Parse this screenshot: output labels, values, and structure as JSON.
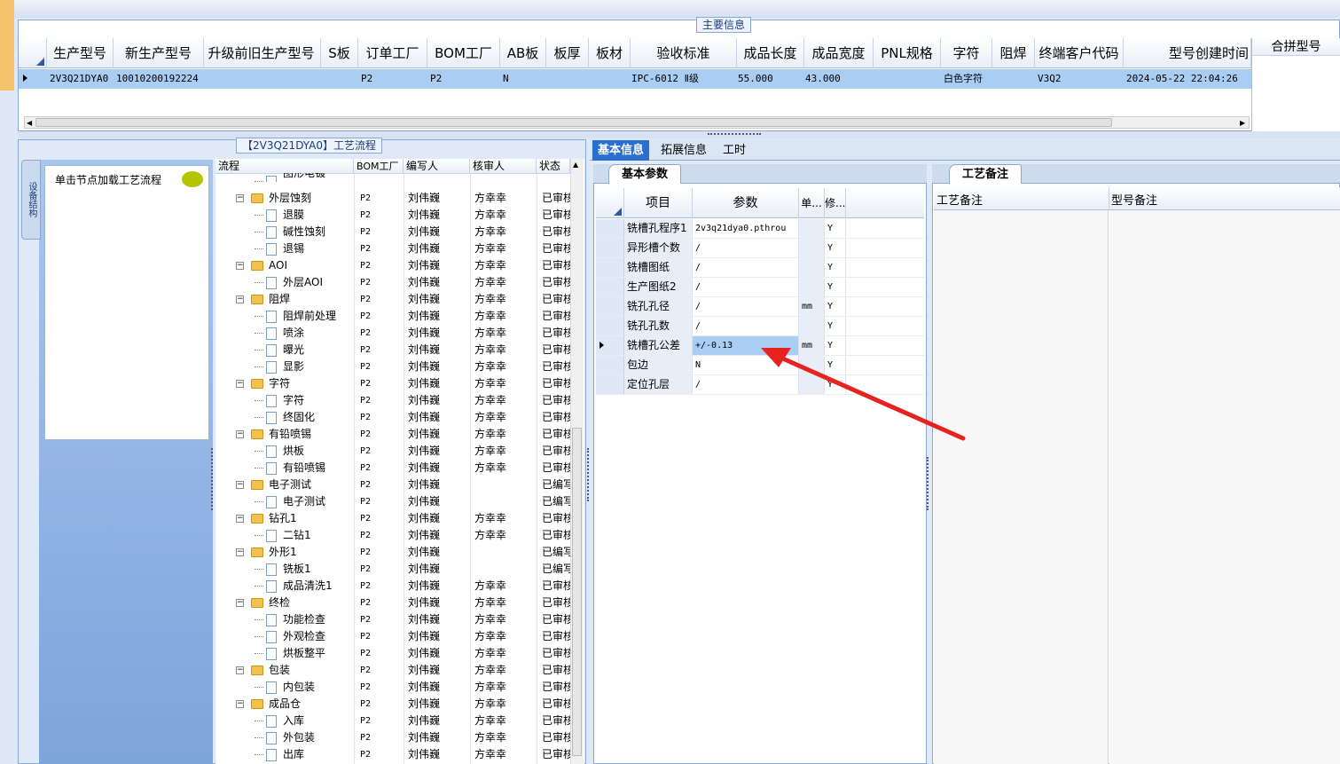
{
  "main_info": {
    "title": "主要信息",
    "columns": [
      "生产型号",
      "新生产型号",
      "升级前旧生产型号",
      "S板",
      "订单工厂",
      "BOM工厂",
      "AB板",
      "板厚",
      "板材",
      "验收标准",
      "成品长度",
      "成品宽度",
      "PNL规格",
      "字符",
      "阻焊",
      "终端客户代码",
      "型号创建时间"
    ],
    "row": [
      "2V3Q21DYA0",
      "10010200192224",
      "",
      "",
      "P2",
      "P2",
      "N",
      "",
      "",
      "IPC-6012 Ⅱ级",
      "55.000",
      "43.000",
      "",
      "白色字符",
      "",
      "V3Q2",
      "2024-05-22 22:04:26"
    ],
    "combo_header": "合拼型号"
  },
  "flow": {
    "title": "【2V3Q21DYA0】工艺流程",
    "side_tab": "设备结构",
    "node_hint": "单击节点加载工艺流程",
    "columns": [
      "流程",
      "BOM工厂",
      "编写人",
      "核审人",
      "状态"
    ],
    "rows": [
      {
        "level": 1,
        "name": "图形电镀",
        "bom": "",
        "writer": "",
        "reviewer": "",
        "status": ""
      },
      {
        "level": 0,
        "name": "外层蚀刻",
        "bom": "P2",
        "writer": "刘伟巍",
        "reviewer": "方幸幸",
        "status": "已审核"
      },
      {
        "level": 1,
        "name": "退膜",
        "bom": "P2",
        "writer": "刘伟巍",
        "reviewer": "方幸幸",
        "status": "已审核"
      },
      {
        "level": 1,
        "name": "碱性蚀刻",
        "bom": "P2",
        "writer": "刘伟巍",
        "reviewer": "方幸幸",
        "status": "已审核"
      },
      {
        "level": 1,
        "name": "退锡",
        "bom": "P2",
        "writer": "刘伟巍",
        "reviewer": "方幸幸",
        "status": "已审核"
      },
      {
        "level": 0,
        "name": "AOI",
        "bom": "P2",
        "writer": "刘伟巍",
        "reviewer": "方幸幸",
        "status": "已审核"
      },
      {
        "level": 1,
        "name": "外层AOI",
        "bom": "P2",
        "writer": "刘伟巍",
        "reviewer": "方幸幸",
        "status": "已审核"
      },
      {
        "level": 0,
        "name": "阻焊",
        "bom": "P2",
        "writer": "刘伟巍",
        "reviewer": "方幸幸",
        "status": "已审核"
      },
      {
        "level": 1,
        "name": "阻焊前处理",
        "bom": "P2",
        "writer": "刘伟巍",
        "reviewer": "方幸幸",
        "status": "已审核"
      },
      {
        "level": 1,
        "name": "喷涂",
        "bom": "P2",
        "writer": "刘伟巍",
        "reviewer": "方幸幸",
        "status": "已审核"
      },
      {
        "level": 1,
        "name": "曝光",
        "bom": "P2",
        "writer": "刘伟巍",
        "reviewer": "方幸幸",
        "status": "已审核"
      },
      {
        "level": 1,
        "name": "显影",
        "bom": "P2",
        "writer": "刘伟巍",
        "reviewer": "方幸幸",
        "status": "已审核"
      },
      {
        "level": 0,
        "name": "字符",
        "bom": "P2",
        "writer": "刘伟巍",
        "reviewer": "方幸幸",
        "status": "已审核"
      },
      {
        "level": 1,
        "name": "字符",
        "bom": "P2",
        "writer": "刘伟巍",
        "reviewer": "方幸幸",
        "status": "已审核"
      },
      {
        "level": 1,
        "name": "终固化",
        "bom": "P2",
        "writer": "刘伟巍",
        "reviewer": "方幸幸",
        "status": "已审核"
      },
      {
        "level": 0,
        "name": "有铅喷锡",
        "bom": "P2",
        "writer": "刘伟巍",
        "reviewer": "方幸幸",
        "status": "已审核"
      },
      {
        "level": 1,
        "name": "烘板",
        "bom": "P2",
        "writer": "刘伟巍",
        "reviewer": "方幸幸",
        "status": "已审核"
      },
      {
        "level": 1,
        "name": "有铅喷锡",
        "bom": "P2",
        "writer": "刘伟巍",
        "reviewer": "方幸幸",
        "status": "已审核"
      },
      {
        "level": 0,
        "name": "电子测试",
        "bom": "P2",
        "writer": "刘伟巍",
        "reviewer": "",
        "status": "已编写"
      },
      {
        "level": 1,
        "name": "电子测试",
        "bom": "P2",
        "writer": "刘伟巍",
        "reviewer": "",
        "status": "已编写"
      },
      {
        "level": 0,
        "name": "钻孔1",
        "bom": "P2",
        "writer": "刘伟巍",
        "reviewer": "方幸幸",
        "status": "已审核"
      },
      {
        "level": 1,
        "name": "二钻1",
        "bom": "P2",
        "writer": "刘伟巍",
        "reviewer": "方幸幸",
        "status": "已审核"
      },
      {
        "level": 0,
        "name": "外形1",
        "bom": "P2",
        "writer": "刘伟巍",
        "reviewer": "",
        "status": "已编写"
      },
      {
        "level": 1,
        "name": "铣板1",
        "bom": "P2",
        "writer": "刘伟巍",
        "reviewer": "",
        "status": "已编写"
      },
      {
        "level": 1,
        "name": "成品清洗1",
        "bom": "P2",
        "writer": "刘伟巍",
        "reviewer": "方幸幸",
        "status": "已审核"
      },
      {
        "level": 0,
        "name": "终检",
        "bom": "P2",
        "writer": "刘伟巍",
        "reviewer": "方幸幸",
        "status": "已审核"
      },
      {
        "level": 1,
        "name": "功能检查",
        "bom": "P2",
        "writer": "刘伟巍",
        "reviewer": "方幸幸",
        "status": "已审核"
      },
      {
        "level": 1,
        "name": "外观检查",
        "bom": "P2",
        "writer": "刘伟巍",
        "reviewer": "方幸幸",
        "status": "已审核"
      },
      {
        "level": 1,
        "name": "烘板整平",
        "bom": "P2",
        "writer": "刘伟巍",
        "reviewer": "方幸幸",
        "status": "已审核"
      },
      {
        "level": 0,
        "name": "包装",
        "bom": "P2",
        "writer": "刘伟巍",
        "reviewer": "方幸幸",
        "status": "已审核"
      },
      {
        "level": 1,
        "name": "内包装",
        "bom": "P2",
        "writer": "刘伟巍",
        "reviewer": "方幸幸",
        "status": "已审核"
      },
      {
        "level": 0,
        "name": "成品仓",
        "bom": "P2",
        "writer": "刘伟巍",
        "reviewer": "方幸幸",
        "status": "已审核"
      },
      {
        "level": 1,
        "name": "入库",
        "bom": "P2",
        "writer": "刘伟巍",
        "reviewer": "方幸幸",
        "status": "已审核"
      },
      {
        "level": 1,
        "name": "外包装",
        "bom": "P2",
        "writer": "刘伟巍",
        "reviewer": "方幸幸",
        "status": "已审核"
      },
      {
        "level": 1,
        "name": "出库",
        "bom": "P2",
        "writer": "刘伟巍",
        "reviewer": "方幸幸",
        "status": "已审核"
      }
    ]
  },
  "tabs": [
    "基本信息",
    "拓展信息",
    "工时"
  ],
  "basic": {
    "tab": "基本参数",
    "columns": [
      "项目",
      "参数",
      "单...",
      "修..."
    ],
    "rows": [
      {
        "item": "铣槽孔程序1",
        "param": "2v3q21dya0.pthrou",
        "unit": "",
        "mod": "Y",
        "selected": false
      },
      {
        "item": "异形槽个数",
        "param": "/",
        "unit": "",
        "mod": "Y",
        "selected": false
      },
      {
        "item": "铣槽图纸",
        "param": "/",
        "unit": "",
        "mod": "Y",
        "selected": false
      },
      {
        "item": "生产图纸2",
        "param": "/",
        "unit": "",
        "mod": "Y",
        "selected": false
      },
      {
        "item": "铣孔孔径",
        "param": "/",
        "unit": "mm",
        "mod": "Y",
        "selected": false
      },
      {
        "item": "铣孔孔数",
        "param": "/",
        "unit": "",
        "mod": "Y",
        "selected": false
      },
      {
        "item": "铣槽孔公差",
        "param": "+/-0.13",
        "unit": "mm",
        "mod": "Y",
        "selected": true
      },
      {
        "item": "包边",
        "param": "N",
        "unit": "",
        "mod": "Y",
        "selected": false
      },
      {
        "item": "定位孔层",
        "param": "/",
        "unit": "",
        "mod": "Y",
        "selected": false
      }
    ]
  },
  "remarks": {
    "tab": "工艺备注",
    "col1": "工艺备注",
    "col2": "型号备注"
  },
  "annotation_color": "#e8231f"
}
